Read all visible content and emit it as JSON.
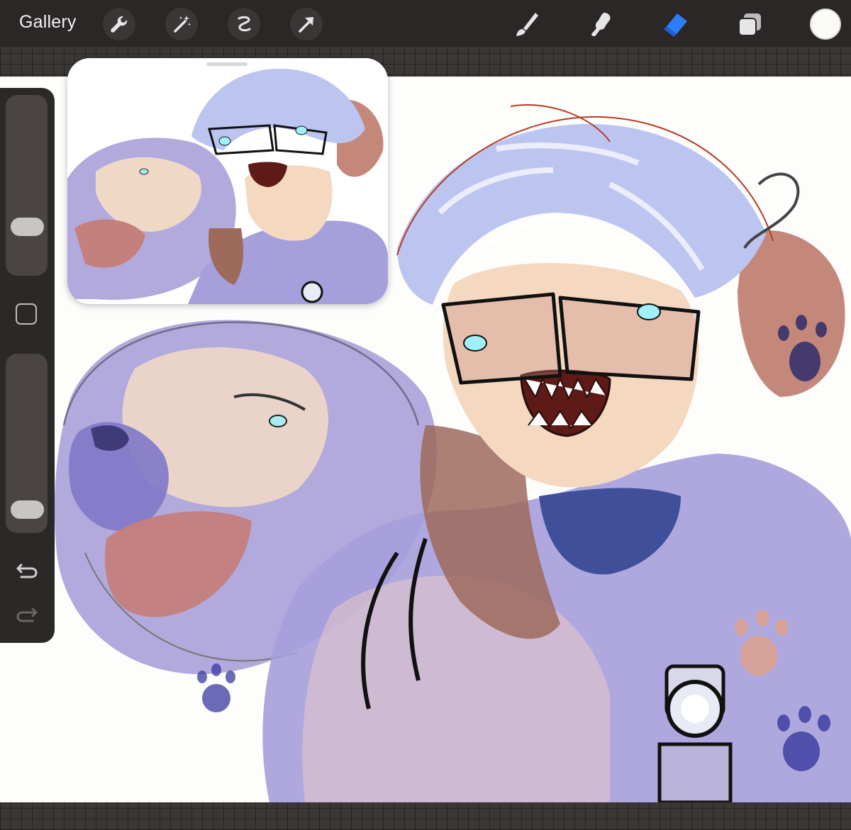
{
  "topbar": {
    "gallery_label": "Gallery",
    "left_tools": [
      "wrench-icon",
      "magic-wand-icon",
      "selection-icon",
      "transform-arrow-icon"
    ],
    "right_tools": [
      "brush-icon",
      "smudge-icon",
      "eraser-icon",
      "layers-icon"
    ],
    "active_tool": "eraser-icon",
    "active_color": "#fbfbf6",
    "accent": "#2f7cf6"
  },
  "sidebar": {
    "size_slider_level": 0.22,
    "opacity_slider_level": 0.05,
    "controls": [
      "modify-square-icon",
      "undo-icon",
      "redo-icon"
    ]
  },
  "colors": {
    "hair": "#b9c2ef",
    "hoodie": "#9a94d8",
    "skin": "#f3d3b8",
    "outline_red": "#b4361f",
    "brown_hair": "#9b6a5c",
    "dog": "#8e86cf",
    "tongue": "#c27b78"
  }
}
